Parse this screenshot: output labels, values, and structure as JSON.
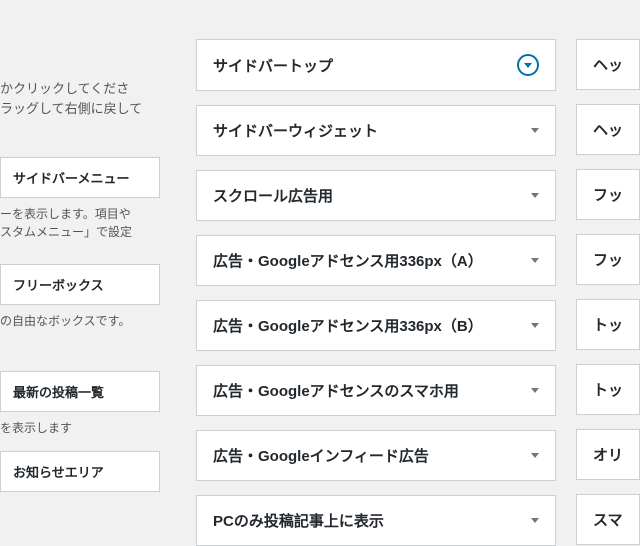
{
  "left": {
    "intro": "かクリックしてくださ\nラッグして右側に戻して",
    "items": [
      {
        "title": "サイドバーメニュー",
        "desc": "ーを表示します。項目や\nスタムメニュー」で設定",
        "top_title": 157,
        "top_desc": 205
      },
      {
        "title": "フリーボックス",
        "desc": "の自由なボックスです。",
        "top_title": 264,
        "top_desc": 312
      },
      {
        "title": "最新の投稿一覧",
        "desc": "を表示します",
        "top_title": 371,
        "top_desc": 419
      },
      {
        "title": "お知らせエリア",
        "desc": "",
        "top_title": 451,
        "top_desc": -1
      }
    ]
  },
  "middle": {
    "areas": [
      {
        "title": "サイドバートップ",
        "highlighted": true
      },
      {
        "title": "サイドバーウィジェット",
        "highlighted": false
      },
      {
        "title": "スクロール広告用",
        "highlighted": false
      },
      {
        "title": "広告・Googleアドセンス用336px（A）",
        "highlighted": false
      },
      {
        "title": "広告・Googleアドセンス用336px（B）",
        "highlighted": false
      },
      {
        "title": "広告・Googleアドセンスのスマホ用",
        "highlighted": false
      },
      {
        "title": "広告・Googleインフィード広告",
        "highlighted": false
      },
      {
        "title": "PCのみ投稿記事上に表示",
        "highlighted": false
      }
    ]
  },
  "right": {
    "areas": [
      {
        "title": "ヘッ"
      },
      {
        "title": "ヘッ"
      },
      {
        "title": "フッ"
      },
      {
        "title": "フッ"
      },
      {
        "title": "トッ"
      },
      {
        "title": "トッ"
      },
      {
        "title": "オリ"
      },
      {
        "title": "スマ"
      }
    ]
  }
}
